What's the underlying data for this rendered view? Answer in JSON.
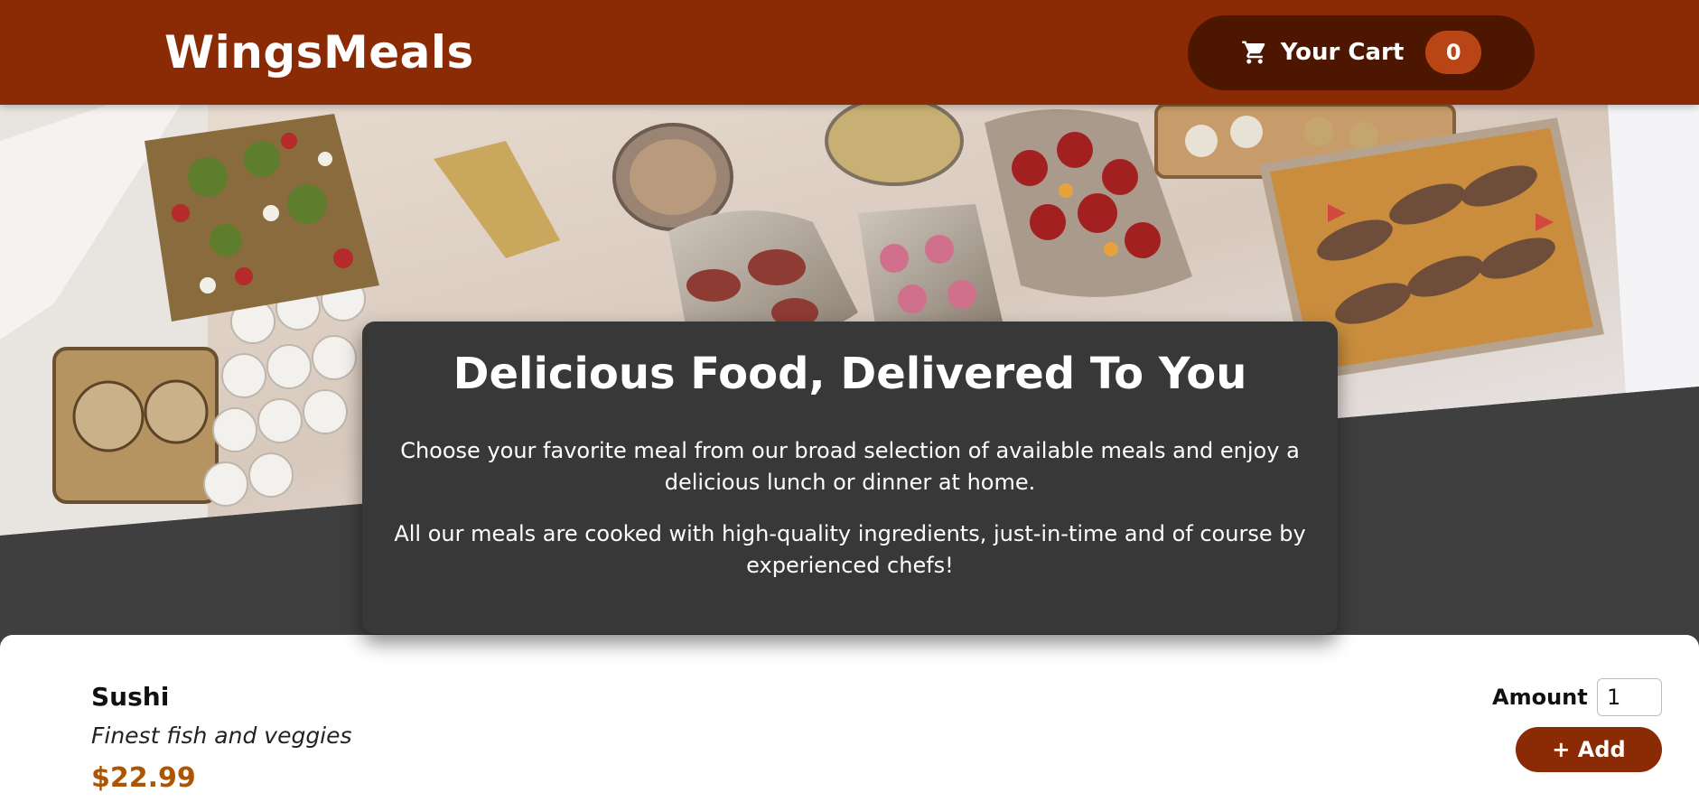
{
  "header": {
    "brand": "WingsMeals",
    "cart": {
      "label": "Your Cart",
      "count": "0",
      "icon": "cart-icon"
    }
  },
  "hero": {
    "image": "buffet-table-photo"
  },
  "summary": {
    "title": "Delicious Food, Delivered To You",
    "paragraphs": [
      "Choose your favorite meal from our broad selection of available meals and enjoy a delicious lunch or dinner at home.",
      "All our meals are cooked with high-quality ingredients, just-in-time and of course by experienced chefs!"
    ]
  },
  "meals": [
    {
      "name": "Sushi",
      "description": "Finest fish and veggies",
      "price": "$22.99",
      "amount_label": "Amount",
      "amount_value": "1",
      "add_label": "+ Add"
    }
  ],
  "colors": {
    "header": "#8a2b06",
    "cart_button": "#4d1601",
    "badge": "#b94517",
    "price": "#ad5502",
    "summary_bg": "#383838"
  }
}
